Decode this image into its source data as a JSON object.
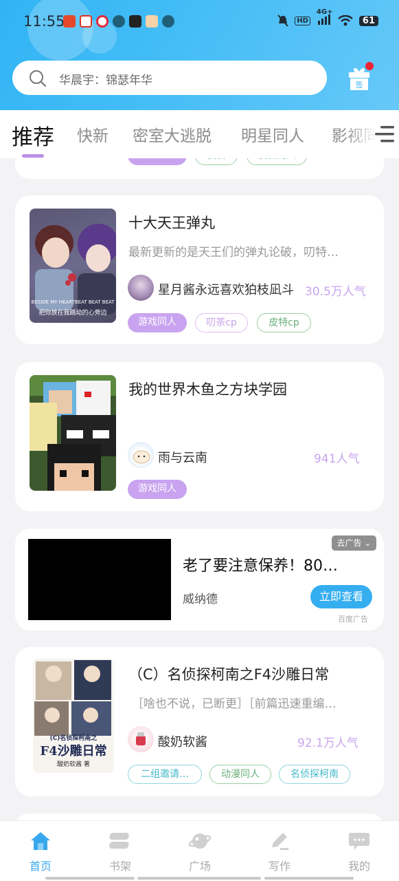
{
  "status_bar": {
    "time": "11:55",
    "battery": "61",
    "network": "4G+",
    "hd": "HD"
  },
  "search": {
    "placeholder": "华晨宇：锦瑟年华"
  },
  "checkin": {
    "label": "签"
  },
  "tabs": [
    {
      "label": "推荐",
      "active": true
    },
    {
      "label": "快新",
      "active": false
    },
    {
      "label": "密室大逃脱",
      "active": false
    },
    {
      "label": "明星同人",
      "active": false
    },
    {
      "label": "影视同人",
      "active": false
    }
  ],
  "partial_card_tags": [
    "动漫同人",
    "快新",
    "快新同人"
  ],
  "books": [
    {
      "title": "十大天王弹丸",
      "desc": "最新更新的是天王们的弹丸论破，叨特…",
      "author": "星月酱永远喜欢狛枝凪斗",
      "popularity": "30.5万人气",
      "tags": [
        "游戏同人",
        "叨茶cp",
        "皮特cp"
      ],
      "cover_caption": "BESIDE MY HEARTBEAT BEAT BEAT",
      "cover_caption2": "把你放在我跳动的心旁边"
    },
    {
      "title": "我的世界木鱼之方块学园",
      "desc": "",
      "author": "雨与云南",
      "popularity": "941人气",
      "tags": [
        "游戏同人"
      ]
    },
    {
      "title": "（C）名侦探柯南之F4沙雕日常",
      "desc": "［啥也不说，已断更］［前篇迅速重编…",
      "author": "酸奶软酱",
      "popularity": "92.1万人气",
      "tags": [
        "二组邀请…",
        "动漫同人",
        "名侦探柯南"
      ],
      "cover_title": "F4沙雕日常",
      "cover_sub": "(C)名侦探柯南之",
      "cover_author": "酸奶软酱 著"
    }
  ],
  "ad": {
    "title": "老了要注意保养！80…",
    "brand": "威纳德",
    "button": "立即查看",
    "close": "去广告",
    "source": "百度广告"
  },
  "bottom_nav": [
    {
      "label": "首页",
      "icon": "home-icon",
      "active": true
    },
    {
      "label": "书架",
      "icon": "bookshelf-icon",
      "active": false
    },
    {
      "label": "广场",
      "icon": "planet-icon",
      "active": false
    },
    {
      "label": "写作",
      "icon": "pen-icon",
      "active": false
    },
    {
      "label": "我的",
      "icon": "chat-bubble-icon",
      "active": false
    }
  ],
  "colors": {
    "accent": "#38a8ee",
    "tag_purple": "#c9a3ef",
    "popularity": "#c8a5ee",
    "badge_red": "#ee2336"
  }
}
